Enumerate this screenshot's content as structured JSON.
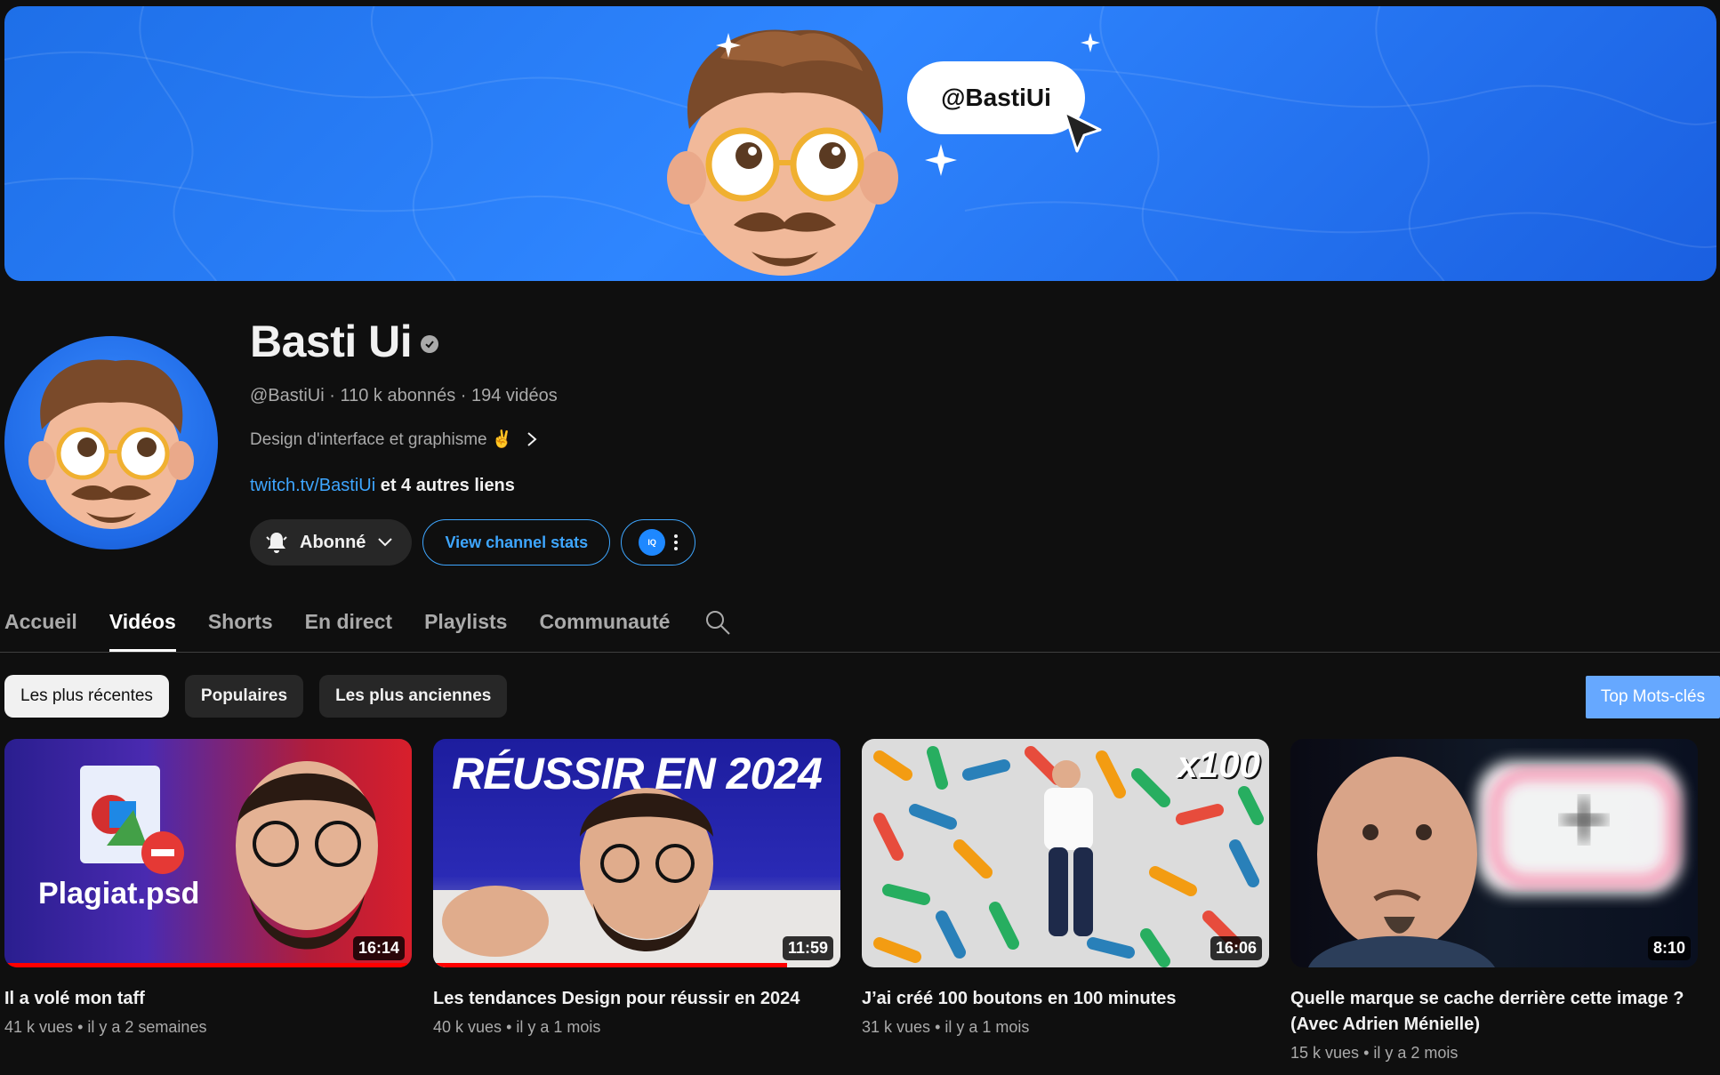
{
  "banner": {
    "handle": "@BastiUi"
  },
  "channel": {
    "name": "Basti Ui",
    "handle": "@BastiUi",
    "subscribers": "110 k abonnés",
    "videos_count": "194 vidéos",
    "separator": "·",
    "description": "Design d'interface et graphisme ✌️",
    "link": "twitch.tv/BastiUi",
    "other_links": "et 4 autres liens"
  },
  "buttons": {
    "subscribed": "Abonné",
    "stats": "View channel stats",
    "extension_badge": "IQ"
  },
  "tabs": [
    {
      "label": "Accueil"
    },
    {
      "label": "Vidéos",
      "active": true
    },
    {
      "label": "Shorts"
    },
    {
      "label": "En direct"
    },
    {
      "label": "Playlists"
    },
    {
      "label": "Communauté"
    }
  ],
  "filters": [
    {
      "label": "Les plus récentes",
      "active": true
    },
    {
      "label": "Populaires"
    },
    {
      "label": "Les plus anciennes"
    }
  ],
  "keywords_button": "Top Mots-clés",
  "videos": [
    {
      "title": "Il a volé mon taff",
      "views": "41 k vues",
      "age": "il y a 2 semaines",
      "duration": "16:14",
      "thumb_text": "Plagiat.psd",
      "progress": 0.99
    },
    {
      "title": "Les tendances Design pour réussir en 2024",
      "views": "40 k vues",
      "age": "il y a 1 mois",
      "duration": "11:59",
      "thumb_text": "RÉUSSIR EN 2024",
      "progress": 0.87
    },
    {
      "title": "J’ai créé 100 boutons en 100 minutes",
      "views": "31 k vues",
      "age": "il y a 1 mois",
      "duration": "16:06",
      "thumb_text": "x100",
      "progress": 0
    },
    {
      "title": "Quelle marque se cache derrière cette image ? (Avec Adrien Ménielle)",
      "views": "15 k vues",
      "age": "il y a 2 mois",
      "duration": "8:10",
      "thumb_text": "",
      "progress": 0
    }
  ],
  "meta_dot": "•",
  "colors": {
    "accent": "#3ea6ff",
    "banner": "#2f86ff",
    "progress": "#ff0000",
    "background": "#0f0f0f"
  }
}
